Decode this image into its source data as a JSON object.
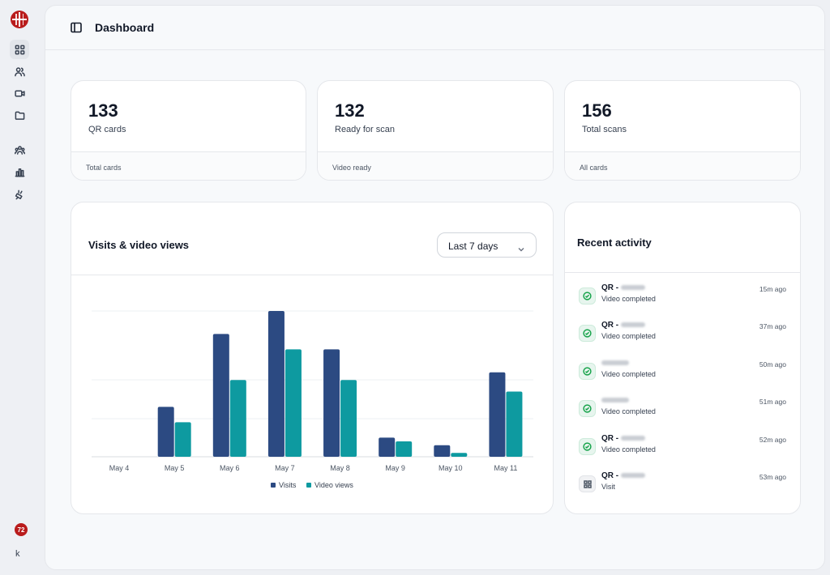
{
  "sidebar": {
    "notification_count": "72",
    "user_initial": "k",
    "nav_icons": [
      "grid-icon",
      "users-icon",
      "video-icon",
      "folder-icon",
      "team-icon",
      "bar-chart-icon",
      "plug-icon"
    ]
  },
  "header": {
    "title": "Dashboard"
  },
  "stats": [
    {
      "value": "133",
      "label": "QR cards",
      "footer": "Total cards"
    },
    {
      "value": "132",
      "label": "Ready for scan",
      "footer": "Video ready"
    },
    {
      "value": "156",
      "label": "Total scans",
      "footer": "All cards"
    }
  ],
  "chart": {
    "title": "Visits & video views",
    "range_label": "Last 7 days"
  },
  "chart_data": {
    "type": "bar",
    "title": "Visits & video views",
    "categories": [
      "May 4",
      "May 5",
      "May 6",
      "May 7",
      "May 8",
      "May 9",
      "May 10",
      "May 11"
    ],
    "series": [
      {
        "name": "Visits",
        "color": "#2c4a82",
        "values": [
          0,
          13,
          32,
          38,
          28,
          5,
          3,
          22
        ]
      },
      {
        "name": "Video views",
        "color": "#0e9aa0",
        "values": [
          0,
          9,
          20,
          28,
          20,
          4,
          1,
          17
        ]
      }
    ],
    "ylim": [
      0,
      38
    ],
    "grid": true,
    "legend": "bottom-center"
  },
  "activity": {
    "title": "Recent activity",
    "items": [
      {
        "prefix": "QR -",
        "status": "Video completed",
        "time": "15m ago",
        "kind": "ok"
      },
      {
        "prefix": "QR -",
        "status": "Video completed",
        "time": "37m ago",
        "kind": "ok"
      },
      {
        "prefix": "",
        "status": "Video completed",
        "time": "50m ago",
        "kind": "ok"
      },
      {
        "prefix": "",
        "status": "Video completed",
        "time": "51m ago",
        "kind": "ok"
      },
      {
        "prefix": "QR -",
        "status": "Video completed",
        "time": "52m ago",
        "kind": "ok"
      },
      {
        "prefix": "QR -",
        "status": "Visit",
        "time": "53m ago",
        "kind": "visit"
      }
    ]
  }
}
